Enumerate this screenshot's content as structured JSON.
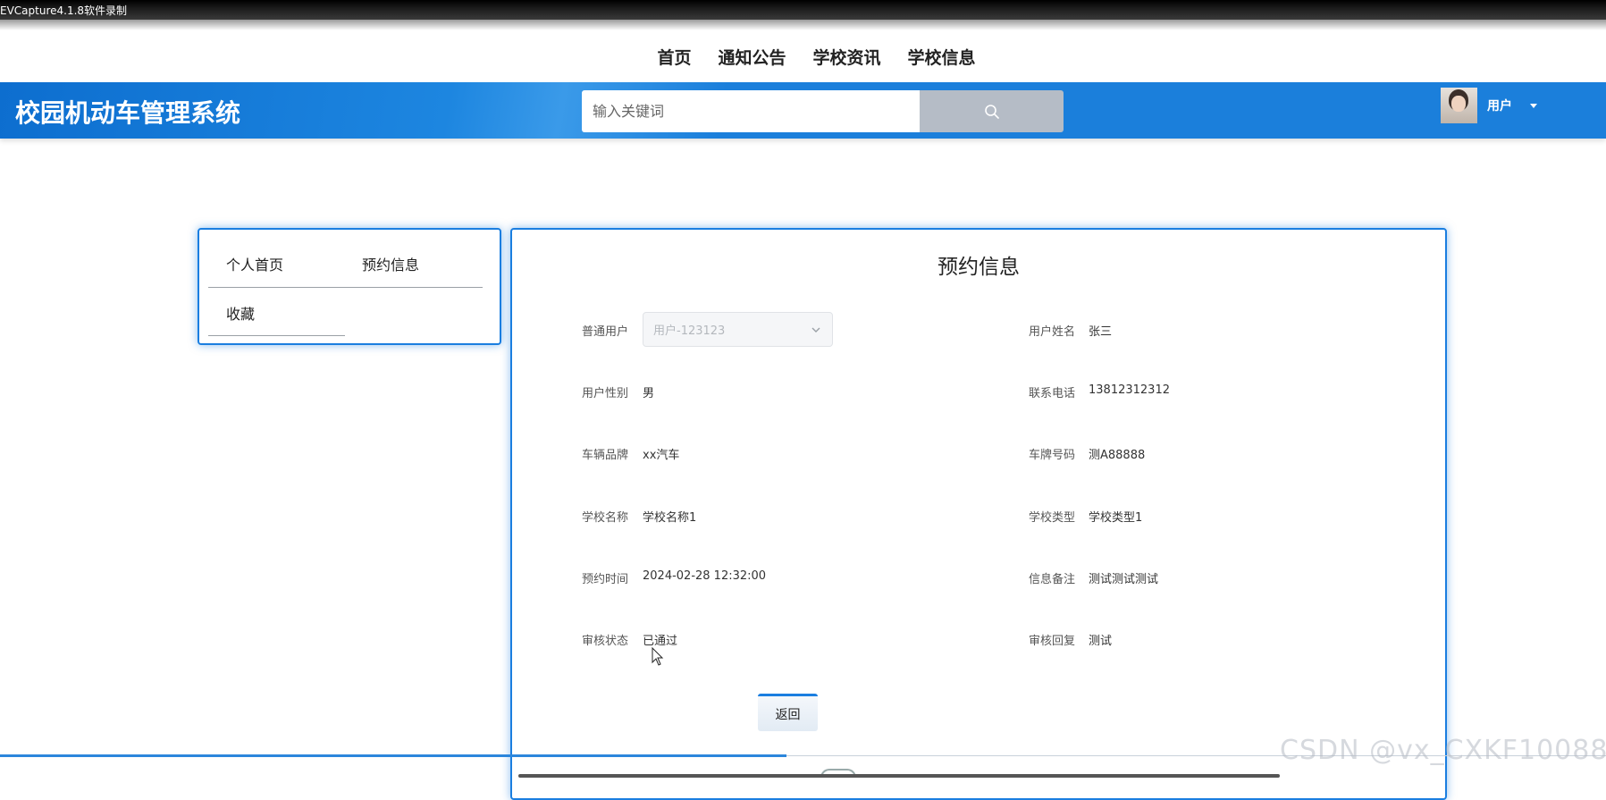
{
  "recorder": {
    "label": "EVCapture4.1.8软件录制"
  },
  "nav": {
    "items": [
      "首页",
      "通知公告",
      "学校资讯",
      "学校信息"
    ]
  },
  "header": {
    "brand": "校园机动车管理系统",
    "search_placeholder": "输入关键词",
    "search_icon": "search-icon",
    "user_label": "用户",
    "accent_color": "#1b7fdb"
  },
  "sidebar": {
    "items": [
      "个人首页",
      "预约信息",
      "收藏"
    ]
  },
  "detail": {
    "title": "预约信息",
    "fields": {
      "user_select": {
        "label": "普通用户",
        "value": "用户-123123"
      },
      "user_name": {
        "label": "用户姓名",
        "value": "张三"
      },
      "gender": {
        "label": "用户性别",
        "value": "男"
      },
      "phone": {
        "label": "联系电话",
        "value": "13812312312"
      },
      "brand": {
        "label": "车辆品牌",
        "value": "xx汽车"
      },
      "plate": {
        "label": "车牌号码",
        "value": "测A88888"
      },
      "school_name": {
        "label": "学校名称",
        "value": "学校名称1"
      },
      "school_type": {
        "label": "学校类型",
        "value": "学校类型1"
      },
      "time": {
        "label": "预约时间",
        "value": "2024-02-28 12:32:00"
      },
      "remark": {
        "label": "信息备注",
        "value": "测试测试测试"
      },
      "status": {
        "label": "审核状态",
        "value": "已通过"
      },
      "reply": {
        "label": "审核回复",
        "value": "测试"
      }
    },
    "back_label": "返回"
  },
  "watermark": "CSDN @vx_CXKF10088"
}
